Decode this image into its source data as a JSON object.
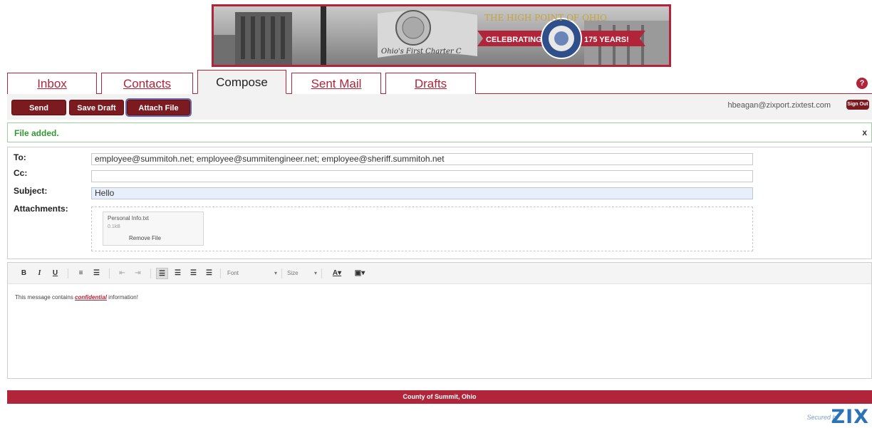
{
  "banner": {
    "ribbon_left": "CELEBRATING",
    "ribbon_right": "175 YEARS!",
    "arc_text": "THE HIGH POINT OF OHIO",
    "script_text": "Ohio's First Charter C"
  },
  "tabs": [
    {
      "label": "Inbox",
      "active": false
    },
    {
      "label": "Contacts",
      "active": false
    },
    {
      "label": "Compose",
      "active": true
    },
    {
      "label": "Sent Mail",
      "active": false
    },
    {
      "label": "Drafts",
      "active": false
    }
  ],
  "help": {
    "glyph": "?"
  },
  "toolbar": {
    "send_label": "Send",
    "save_draft_label": "Save Draft",
    "attach_file_label": "Attach File",
    "user_email": "hbeagan@zixport.zixtest.com",
    "sign_out_label": "Sign Out"
  },
  "notice": {
    "text": "File added.",
    "close": "x"
  },
  "form": {
    "to_label": "To:",
    "to_value": "employee@summitoh.net; employee@summitengineer.net; employee@sheriff.summitoh.net",
    "cc_label": "Cc:",
    "cc_value": "",
    "subject_label": "Subject:",
    "subject_value": "Hello",
    "attachments_label": "Attachments:",
    "attachment": {
      "name": "Personal Info.txt",
      "size": "0.1kB",
      "remove_label": "Remove File"
    }
  },
  "editor": {
    "bold": "B",
    "italic": "I",
    "underline": "U",
    "font_label": "Font",
    "size_label": "Size",
    "body_before": "This message contains ",
    "body_emph": "confidential",
    "body_after": " information!"
  },
  "footer": {
    "text": "County of Summit, Ohio"
  },
  "secured": {
    "by": "Secured by",
    "brand": "ZIX"
  },
  "colors": {
    "brand_red": "#b0253a",
    "button_red": "#7b1a1f",
    "success_green": "#2f9b2f",
    "zix_blue": "#2b73b8"
  }
}
